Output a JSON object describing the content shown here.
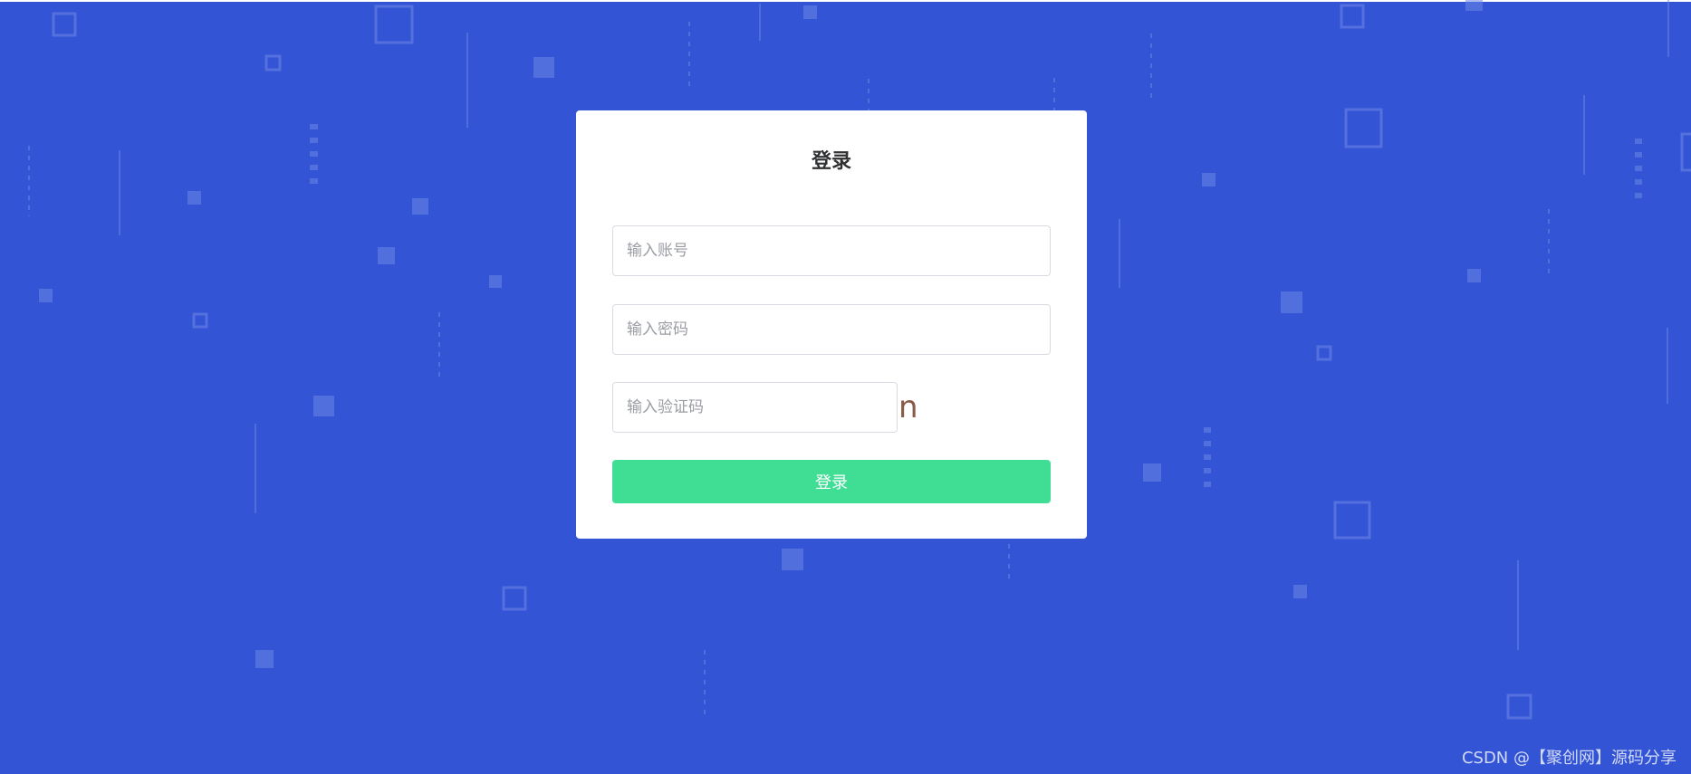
{
  "login_card": {
    "title": "登录",
    "account_placeholder": "输入账号",
    "password_placeholder": "输入密码",
    "captcha_placeholder": "输入验证码",
    "captcha_text": "n",
    "submit_label": "登录"
  },
  "watermark": {
    "text": "CSDN @【聚创网】源码分享"
  },
  "colors": {
    "background": "#3254D5",
    "card": "#FFFFFF",
    "button": "#40DD95",
    "decoration": "#6B86E6"
  }
}
